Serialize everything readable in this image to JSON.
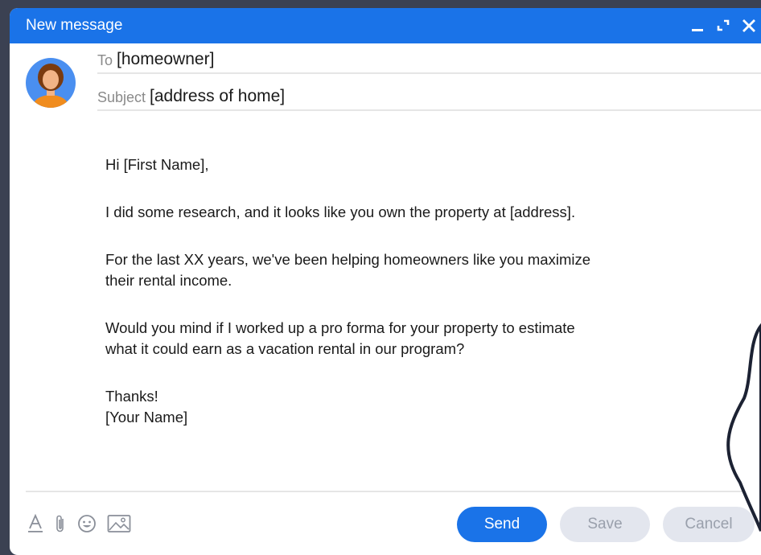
{
  "window": {
    "title": "New message",
    "minimize_icon": "minimize-icon",
    "expand_icon": "expand-icon",
    "close_icon": "close-icon"
  },
  "header": {
    "to_label": "To",
    "to_value": "[homeowner]",
    "subject_label": "Subject",
    "subject_value": "[address of home]"
  },
  "body": {
    "greeting": "Hi [First Name],",
    "para1": "I did some research, and it looks like you own the property at [address].",
    "para2_line1": "For the last XX years, we've been helping homeowners like you maximize",
    "para2_line2": "their rental income.",
    "para3_line1": "Would you mind if I worked up a pro forma for your property to estimate",
    "para3_line2": "what it could earn as a vacation rental in our program?",
    "signoff": "Thanks!",
    "signature": "[Your Name]"
  },
  "toolbar": {
    "format_icon": "text-format-icon",
    "attach_icon": "paperclip-icon",
    "emoji_icon": "emoji-icon",
    "image_icon": "image-icon"
  },
  "actions": {
    "send_label": "Send",
    "save_label": "Save",
    "cancel_label": "Cancel"
  },
  "colors": {
    "accent": "#1a73e8",
    "disabled_button_bg": "#e3e6ee",
    "disabled_button_text": "#9aa0ac",
    "avatar_bg": "#4a8ff0",
    "avatar_hair": "#7a3b10",
    "avatar_shirt": "#f08c1e"
  }
}
